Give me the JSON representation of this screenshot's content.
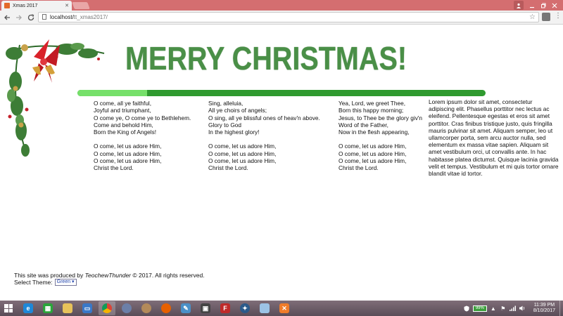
{
  "browser": {
    "tab_title": "Xmas 2017",
    "tab_close": "✕",
    "url_host": "localhost/",
    "url_path": "tt_xmas2017/"
  },
  "page": {
    "headline": "MERRY CHRISTMAS!",
    "progress_fraction": 0.17,
    "verses": [
      {
        "stanza1": [
          "O come, all ye faithful,",
          "Joyful and triumphant,",
          "O come ye, O come ye to Bethlehem.",
          "Come and behold Him,",
          "Born the King of Angels!"
        ],
        "refrain": [
          "O come, let us adore Him,",
          "O come, let us adore Him,",
          "O come, let us adore Him,",
          "Christ the Lord."
        ]
      },
      {
        "stanza1": [
          "Sing, alleluia,",
          "All ye choirs of angels;",
          "O sing, all ye blissful ones of heav'n above.",
          "Glory to God",
          "In the highest glory!"
        ],
        "refrain": [
          "O come, let us adore Him,",
          "O come, let us adore Him,",
          "O come, let us adore Him,",
          "Christ the Lord."
        ]
      },
      {
        "stanza1": [
          "Yea, Lord, we greet Thee,",
          "Born this happy morning;",
          "Jesus, to Thee be the glory giv'n",
          "Word of the Father,",
          "Now in the flesh appearing,"
        ],
        "refrain": [
          "O come, let us adore Him,",
          "O come, let us adore Him,",
          "O come, let us adore Him,",
          "Christ the Lord."
        ]
      }
    ],
    "lorem": "Lorem ipsum dolor sit amet, consectetur adipiscing elit. Phasellus porttitor nec lectus ac eleifend. Pellentesque egestas et eros sit amet porttitor. Cras finibus tristique justo, quis fringilla mauris pulvinar sit amet. Aliquam semper, leo ut ullamcorper porta, sem arcu auctor nulla, sed elementum ex massa vitae sapien. Aliquam sit amet vestibulum orci, ut convallis ante. In hac habitasse platea dictumst. Quisque lacinia gravida velit et tempus. Vestibulum et mi quis tortor ornare blandit vitae id tortor.",
    "footer": {
      "prefix": "This site was produced by ",
      "author": "TeochewThunder",
      "suffix": " © 2017. All rights reserved.",
      "theme_label": "Select Theme:",
      "theme_value": "Green ▾"
    }
  },
  "taskbar": {
    "battery": "99%",
    "time": "11:39 PM",
    "date": "8/10/2017"
  },
  "colors": {
    "headline": "#4a8f47",
    "progress_track": "#2f9a2f",
    "progress_fill": "#76e06a"
  }
}
